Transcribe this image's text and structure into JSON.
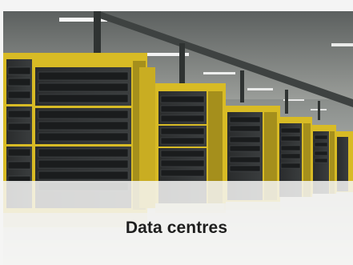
{
  "card": {
    "caption": "Data centres"
  },
  "photo": {
    "subject": "server-racks",
    "accent_color": "#e2c42a"
  }
}
